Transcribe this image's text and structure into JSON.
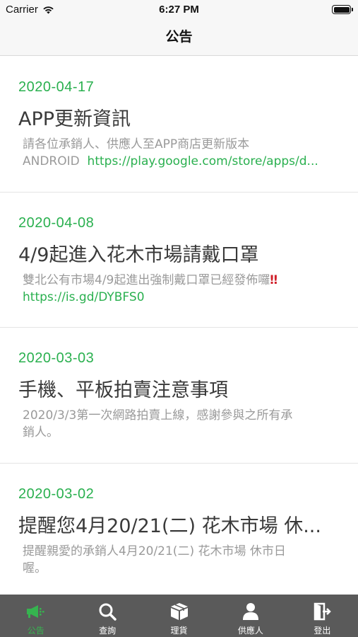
{
  "status_bar": {
    "carrier": "Carrier",
    "time": "6:27 PM"
  },
  "nav": {
    "title": "公告"
  },
  "announcements": [
    {
      "date": "2020-04-17",
      "title": "APP更新資訊",
      "body_line1": "請各位承銷人、供應人至APP商店更新版本",
      "body_line2_prefix": "ANDROID  ",
      "body_line2_link": "https://play.google.com/store/apps/d..."
    },
    {
      "date": "2020-04-08",
      "title": "4/9起進入花木市場請戴口罩",
      "body_line1": "雙北公有市場4/9起進出強制戴口罩已經發佈囉",
      "body_line1_emoji": "‼",
      "body_line2_link": "https://is.gd/DYBFS0"
    },
    {
      "date": "2020-03-03",
      "title": "手機、平板拍賣注意事項",
      "body_line1": "2020/3/3第一次網路拍賣上線，感謝參與之所有承",
      "body_line2": "銷人。"
    },
    {
      "date": "2020-03-02",
      "title": "提醒您4月20/21(二) 花木市場 休...",
      "body_line1": "提醒親愛的承銷人4月20/21(二) 花木市場 休市日",
      "body_line2": "喔。"
    }
  ],
  "tab_bar": {
    "tabs": [
      {
        "label": "公告",
        "icon": "megaphone-icon",
        "active": true
      },
      {
        "label": "查詢",
        "icon": "search-icon",
        "active": false
      },
      {
        "label": "理貨",
        "icon": "box-icon",
        "active": false
      },
      {
        "label": "供應人",
        "icon": "person-icon",
        "active": false
      },
      {
        "label": "登出",
        "icon": "logout-icon",
        "active": false
      }
    ],
    "active_color": "#36b44f",
    "background": "#5a5a5a"
  },
  "colors": {
    "accent_green": "#2ab04f",
    "body_gray": "#9a9a9a"
  }
}
